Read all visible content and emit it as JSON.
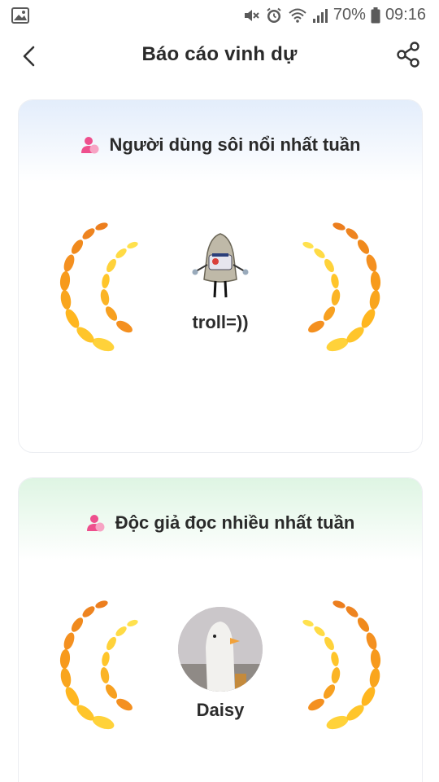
{
  "status_bar": {
    "battery_percent": "70%",
    "time": "09:16",
    "icons": [
      "image-icon",
      "mute-icon",
      "alarm-icon",
      "wifi-icon",
      "signal-icon",
      "battery-icon"
    ]
  },
  "app_bar": {
    "title": "Báo cáo vinh dự",
    "icons": [
      "back-arrow-icon",
      "share-icon"
    ]
  },
  "sections": [
    {
      "title": "Người dùng sôi nổi nhất tuần",
      "winner_name": "troll=))",
      "accent": "#dceafb"
    },
    {
      "title": "Độc giả đọc nhiều nhất tuần",
      "winner_name": "Daisy",
      "accent": "#dcf4e1"
    }
  ],
  "colors": {
    "laurel_light": "#ffd23a",
    "laurel_dark": "#f08a1d",
    "user_icon": "#ee4f8d"
  }
}
